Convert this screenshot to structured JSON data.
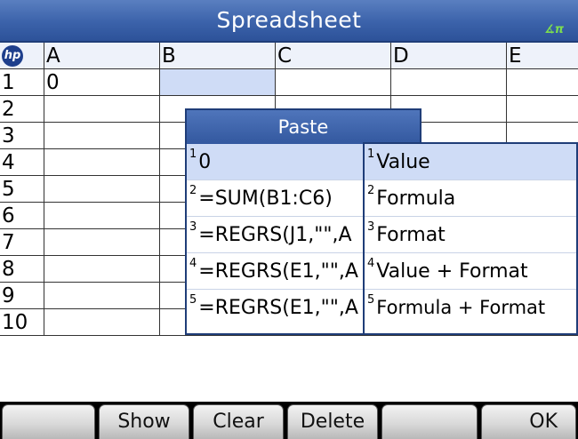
{
  "app": {
    "title": "Spreadsheet",
    "angle_indicator": "∡π",
    "logo_text": "hp"
  },
  "columns": [
    "A",
    "B",
    "C",
    "D",
    "E"
  ],
  "rows": [
    "1",
    "2",
    "3",
    "4",
    "5",
    "6",
    "7",
    "8",
    "9",
    "10"
  ],
  "cells": {
    "A1": "0"
  },
  "selected_cell": "B1",
  "paste_menu": {
    "title": "Paste",
    "items": [
      {
        "num": "1",
        "label": "0"
      },
      {
        "num": "2",
        "label": "=SUM(B1:C6)"
      },
      {
        "num": "3",
        "label": "=REGRS(J1,\"\",A"
      },
      {
        "num": "4",
        "label": "=REGRS(E1,\"\",A"
      },
      {
        "num": "5",
        "label": "=REGRS(E1,\"\",A"
      }
    ]
  },
  "sub_menu": {
    "items": [
      {
        "num": "1",
        "label": "Value"
      },
      {
        "num": "2",
        "label": "Formula"
      },
      {
        "num": "3",
        "label": "Format"
      },
      {
        "num": "4",
        "label": "Value + Format"
      },
      {
        "num": "5",
        "label": "Formula + Format"
      }
    ]
  },
  "softkeys": [
    "",
    "Show",
    "Clear",
    "Delete",
    "",
    "OK"
  ],
  "colors": {
    "title_bar": "#3b62aa",
    "highlight": "#cfdcf6",
    "angle": "#7dde4f"
  }
}
